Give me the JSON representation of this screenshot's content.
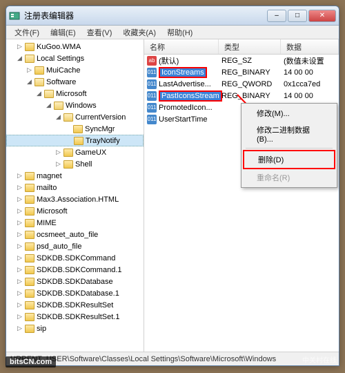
{
  "window": {
    "title": "注册表编辑器"
  },
  "menubar": {
    "file": "文件(F)",
    "edit": "编辑(E)",
    "view": "查看(V)",
    "favorites": "收藏夹(A)",
    "help": "帮助(H)"
  },
  "tree": [
    {
      "indent": 1,
      "exp": "▷",
      "label": "KuGoo.WMA"
    },
    {
      "indent": 1,
      "exp": "◢",
      "label": "Local Settings",
      "open": true
    },
    {
      "indent": 2,
      "exp": "▷",
      "label": "MuiCache"
    },
    {
      "indent": 2,
      "exp": "◢",
      "label": "Software",
      "open": true
    },
    {
      "indent": 3,
      "exp": "◢",
      "label": "Microsoft",
      "open": true
    },
    {
      "indent": 4,
      "exp": "◢",
      "label": "Windows",
      "open": true
    },
    {
      "indent": 5,
      "exp": "◢",
      "label": "CurrentVersion",
      "open": true
    },
    {
      "indent": 6,
      "exp": "",
      "label": "SyncMgr"
    },
    {
      "indent": 6,
      "exp": "",
      "label": "TrayNotify",
      "selected": true
    },
    {
      "indent": 5,
      "exp": "▷",
      "label": "GameUX"
    },
    {
      "indent": 5,
      "exp": "▷",
      "label": "Shell"
    },
    {
      "indent": 1,
      "exp": "▷",
      "label": "magnet"
    },
    {
      "indent": 1,
      "exp": "▷",
      "label": "mailto"
    },
    {
      "indent": 1,
      "exp": "▷",
      "label": "Max3.Association.HTML"
    },
    {
      "indent": 1,
      "exp": "▷",
      "label": "Microsoft"
    },
    {
      "indent": 1,
      "exp": "▷",
      "label": "MIME"
    },
    {
      "indent": 1,
      "exp": "▷",
      "label": "ocsmeet_auto_file"
    },
    {
      "indent": 1,
      "exp": "▷",
      "label": "psd_auto_file"
    },
    {
      "indent": 1,
      "exp": "▷",
      "label": "SDKDB.SDKCommand"
    },
    {
      "indent": 1,
      "exp": "▷",
      "label": "SDKDB.SDKCommand.1"
    },
    {
      "indent": 1,
      "exp": "▷",
      "label": "SDKDB.SDKDatabase"
    },
    {
      "indent": 1,
      "exp": "▷",
      "label": "SDKDB.SDKDatabase.1"
    },
    {
      "indent": 1,
      "exp": "▷",
      "label": "SDKDB.SDKResultSet"
    },
    {
      "indent": 1,
      "exp": "▷",
      "label": "SDKDB.SDKResultSet.1"
    },
    {
      "indent": 1,
      "exp": "▷",
      "label": "sip"
    }
  ],
  "columns": {
    "name": "名称",
    "type": "类型",
    "data": "数据"
  },
  "values": [
    {
      "icon": "str",
      "name": "(默认)",
      "type": "REG_SZ",
      "data": "(数值未设置"
    },
    {
      "icon": "bin",
      "name": "IconStreams",
      "type": "REG_BINARY",
      "data": "14 00 00",
      "hl": true
    },
    {
      "icon": "bin",
      "name": "LastAdvertise...",
      "type": "REG_QWORD",
      "data": "0x1cca7ed"
    },
    {
      "icon": "bin",
      "name": "PastIconsStream",
      "type": "REG_BINARY",
      "data": "14 00 00",
      "hl": true
    },
    {
      "icon": "bin",
      "name": "PromotedIcon...",
      "type": "",
      "data": ""
    },
    {
      "icon": "bin",
      "name": "UserStartTime",
      "type": "",
      "data": ""
    }
  ],
  "context_menu": {
    "modify": "修改(M)...",
    "modify_binary": "修改二进制数据(B)...",
    "delete": "删除(D)",
    "rename": "重命名(R)"
  },
  "statusbar": {
    "path": "URRENT_USER\\Software\\Classes\\Local Settings\\Software\\Microsoft\\Windows"
  },
  "watermarks": {
    "bl": "bitsCN.com",
    "br": "中关村在线"
  }
}
